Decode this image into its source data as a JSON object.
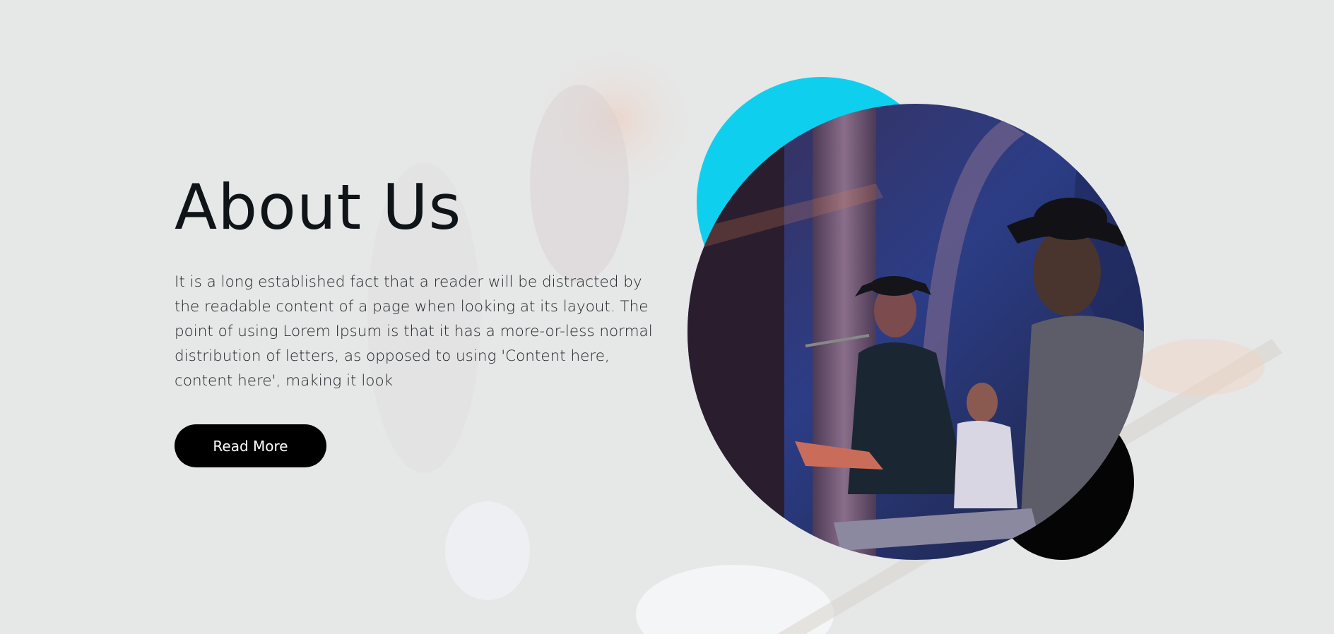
{
  "about": {
    "title": "About Us",
    "description": "It is a long established fact that a reader will be distracted by the readable content of a page when looking at its layout. The point of using Lorem Ipsum is that it has a more-or-less normal distribution of letters, as opposed to using 'Content here, content here', making it look",
    "button_label": "Read More"
  },
  "colors": {
    "background": "#e6e7e7",
    "accent_circle": "#0fcfee",
    "dark_circle": "#050505",
    "button_bg": "#000000",
    "button_text": "#ffffff"
  },
  "images": {
    "background": "faded-guitarist-photo",
    "featured": "band-performing-on-stage-photo"
  }
}
